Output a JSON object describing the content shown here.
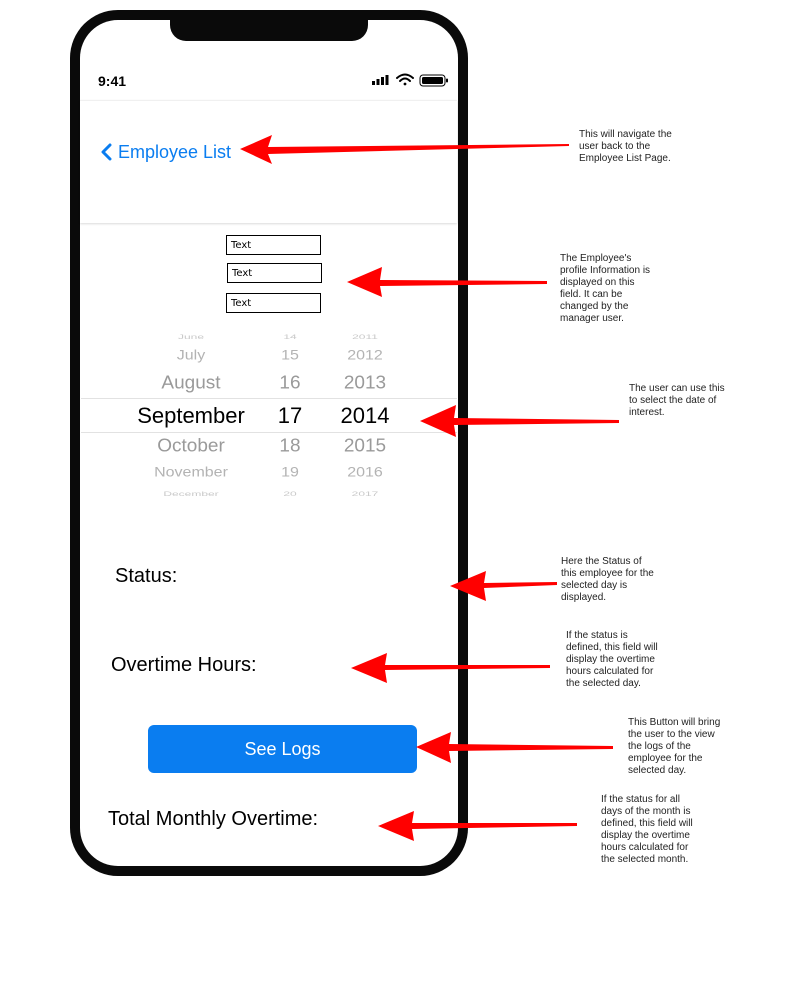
{
  "status_bar": {
    "time": "9:41"
  },
  "nav": {
    "back_label": "Employee List"
  },
  "profile_fields": [
    {
      "value": "Text"
    },
    {
      "value": "Text"
    },
    {
      "value": "Text"
    }
  ],
  "date_picker": {
    "months": [
      "June",
      "July",
      "August",
      "September",
      "October",
      "November",
      "December"
    ],
    "days": [
      "14",
      "15",
      "16",
      "17",
      "18",
      "19",
      "20"
    ],
    "years": [
      "2011",
      "2012",
      "2013",
      "2014",
      "2015",
      "2016",
      "2017"
    ],
    "selected": {
      "month": "September",
      "day": "17",
      "year": "2014"
    }
  },
  "labels": {
    "status": "Status:",
    "overtime_hours": "Overtime Hours:",
    "total_monthly_overtime": "Total Monthly Overtime:"
  },
  "button": {
    "see_logs": "See Logs"
  },
  "annotations": {
    "back": "This will navigate the\nuser back to the\nEmployee List Page.",
    "profile": "The Employee's\nprofile  Information is\ndisplayed on this\nfield. It can be\nchanged by the\nmanager user.",
    "date": "The user can use this\nto select the date of\ninterest.",
    "status": "Here the Status of\nthis employee for the\nselected day is\ndisplayed.",
    "overtime": "If the status is\ndefined, this field will\ndisplay the overtime\nhours calculated for\nthe selected day.",
    "logs": "This Button will bring\nthe user to the view\nthe logs of the\nemployee for the\nselected day.",
    "monthly": "If the status for all\ndays of the month is\ndefined, this field will\ndisplay the overtime\nhours calculated for\nthe selected month."
  },
  "colors": {
    "accent": "#0a7df0",
    "annotation_arrow": "#ff0000",
    "device_frame": "#0a0a0a"
  },
  "icons": [
    "chevron-left-icon",
    "cellular-signal-icon",
    "wifi-icon",
    "battery-icon",
    "arrow-icon"
  ]
}
